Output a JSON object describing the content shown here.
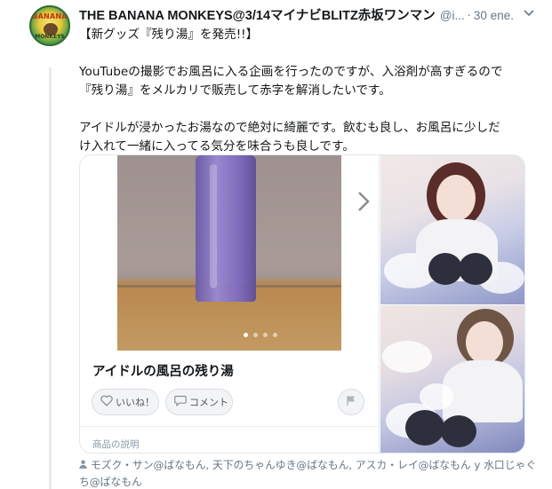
{
  "tweet": {
    "display_name": "THE BANANA MONKEYS@3/14マイナビBLITZ赤坂ワンマン",
    "handle": "@i...",
    "separator": "·",
    "timestamp": "30 ene.",
    "text_lines": [
      "【新グッズ『残り湯』を発売!!】",
      "YouTubeの撮影でお風呂に入る企画を行ったのですが、入浴剤が高すぎるので",
      "『残り湯』をメルカリで販売して赤字を解消したいです。",
      "アイドルが浸かったお湯なので絶対に綺麗です。飲むも良し、お風呂に少しだ",
      "け入れて一緒に入ってる気分を味合うも良しです。"
    ],
    "tagged_people": "モズク・サン@ばなもん, 天下のちゃんゆき@ばなもん, アスカ・レイ@ばなもん y 水口じゃぐち@ばなもん"
  },
  "avatar": {
    "logo_top": "BANANA",
    "logo_bottom": "MONKEYS"
  },
  "card": {
    "product_title": "アイドルの風呂の残り湯",
    "like_label": "いいね！",
    "comment_label": "コメント",
    "description_label": "商品の説明",
    "carousel_count": 4,
    "carousel_active_index": 0
  },
  "icons": {
    "chevron": "chevron-down-icon",
    "next": "chevron-right-icon",
    "like": "heart-icon",
    "comment": "speech-bubble-icon",
    "flag": "flag-icon",
    "person": "person-icon"
  },
  "colors": {
    "text_primary": "#14171a",
    "text_secondary": "#657786",
    "border": "#e1e8ed",
    "bottle": "#8a78c8"
  }
}
